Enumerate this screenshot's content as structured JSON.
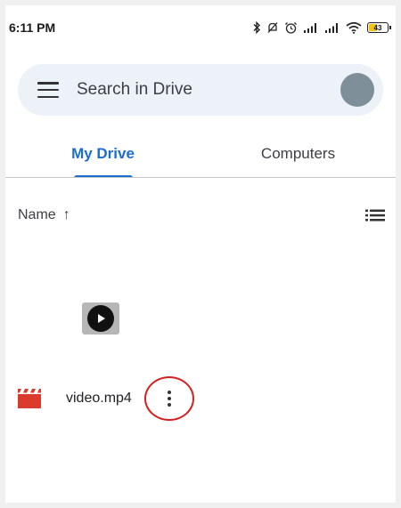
{
  "status_bar": {
    "time": "6:11 PM",
    "icons": [
      "bluetooth-icon",
      "mute-icon",
      "alarm-icon",
      "signal-icon",
      "signal-icon",
      "wifi-icon"
    ],
    "battery_level": "43",
    "battery_color": "#f2c40f"
  },
  "search": {
    "placeholder": "Search in Drive"
  },
  "tabs": [
    {
      "label": "My Drive",
      "active": true
    },
    {
      "label": "Computers",
      "active": false
    }
  ],
  "list_header": {
    "sort_label": "Name",
    "sort_arrow": "↑"
  },
  "files": [
    {
      "name": "video.mp4",
      "type_icon": "video-file-icon",
      "icon_color": "#db3b2c"
    }
  ],
  "accent_color": "#1a6dd1"
}
